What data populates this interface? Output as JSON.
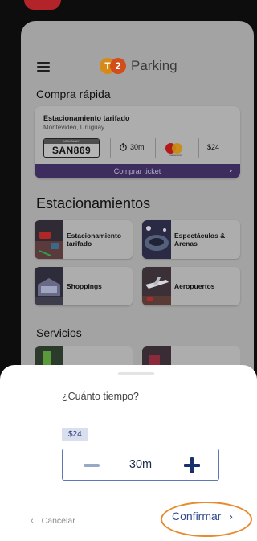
{
  "header": {
    "app_name": "Parking",
    "logo_digit": "2",
    "logo_letter": "T"
  },
  "quick_buy": {
    "title": "Compra rápida",
    "service": "Estacionamiento tarifado",
    "location": "Montevideo, Uruguay",
    "plate_country": "URUGUAY",
    "plate": "SAN869",
    "duration": "30m",
    "card_brand": "mastercard",
    "price": "$24",
    "buy_label": "Comprar ticket"
  },
  "parking": {
    "title": "Estacionamientos",
    "items": [
      {
        "label": "Estacionamiento tarifado"
      },
      {
        "label": "Espectáculos & Arenas"
      },
      {
        "label": "Shoppings"
      },
      {
        "label": "Aeropuertos"
      }
    ]
  },
  "services": {
    "title": "Servicios"
  },
  "sheet": {
    "question": "¿Cuánto tiempo?",
    "price": "$24",
    "duration": "30m",
    "cancel_label": "Cancelar",
    "confirm_label": "Confirmar"
  },
  "colors": {
    "accent": "#3c2d5e",
    "confirm": "#2f4a8a",
    "highlight": "#e88a2d"
  }
}
